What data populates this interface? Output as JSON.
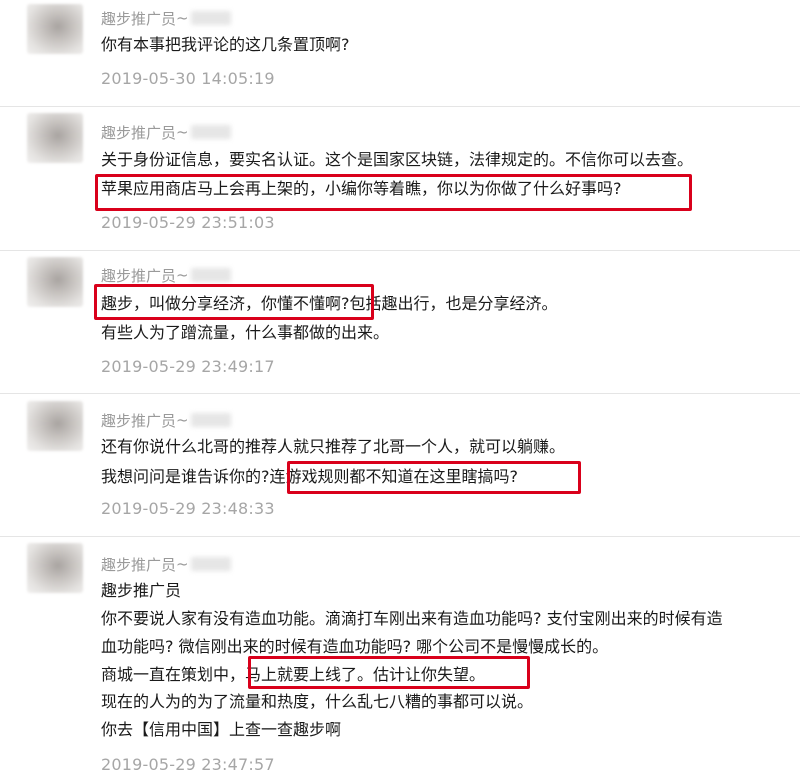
{
  "comments": [
    {
      "author": "趣步推广员",
      "author_suffix": "~",
      "lines": [
        "你有本事把我评论的这几条置顶啊?"
      ],
      "time": "2019-05-30 14:05:19"
    },
    {
      "author": "趣步推广员",
      "author_suffix": "~",
      "lines": [
        "关于身份证信息，要实名认证。这个是国家区块链，法律规定的。不信你可以去查。",
        "苹果应用商店马上会再上架的，小编你等着瞧，你以为你做了什么好事吗?"
      ],
      "time": "2019-05-29 23:51:03"
    },
    {
      "author": "趣步推广员",
      "author_suffix": "~",
      "lines": [
        "趣步，叫做分享经济，你懂不懂啊?包括趣出行，也是分享经济。",
        "有些人为了蹭流量，什么事都做的出来。"
      ],
      "time": "2019-05-29 23:49:17"
    },
    {
      "author": "趣步推广员",
      "author_suffix": "~",
      "lines": [
        "还有你说什么北哥的推荐人就只推荐了北哥一个人，就可以躺赚。",
        "我想问问是谁告诉你的?连游戏规则都不知道在这里瞎搞吗?"
      ],
      "time": "2019-05-29 23:48:33"
    },
    {
      "author": "趣步推广员",
      "author_suffix": "~",
      "lines": [
        "趣步推广员",
        "你不要说人家有没有造血功能。滴滴打车刚出来有造血功能吗? 支付宝刚出来的时候有造",
        "血功能吗? 微信刚出来的时候有造血功能吗? 哪个公司不是慢慢成长的。",
        "商城一直在策划中，马上就要上线了。估计让你失望。",
        "现在的人为的为了流量和热度，什么乱七八糟的事都可以说。",
        "你去【信用中国】上查一查趣步啊"
      ],
      "time": "2019-05-29 23:47:57"
    }
  ],
  "highlight_color": "#d9001b"
}
